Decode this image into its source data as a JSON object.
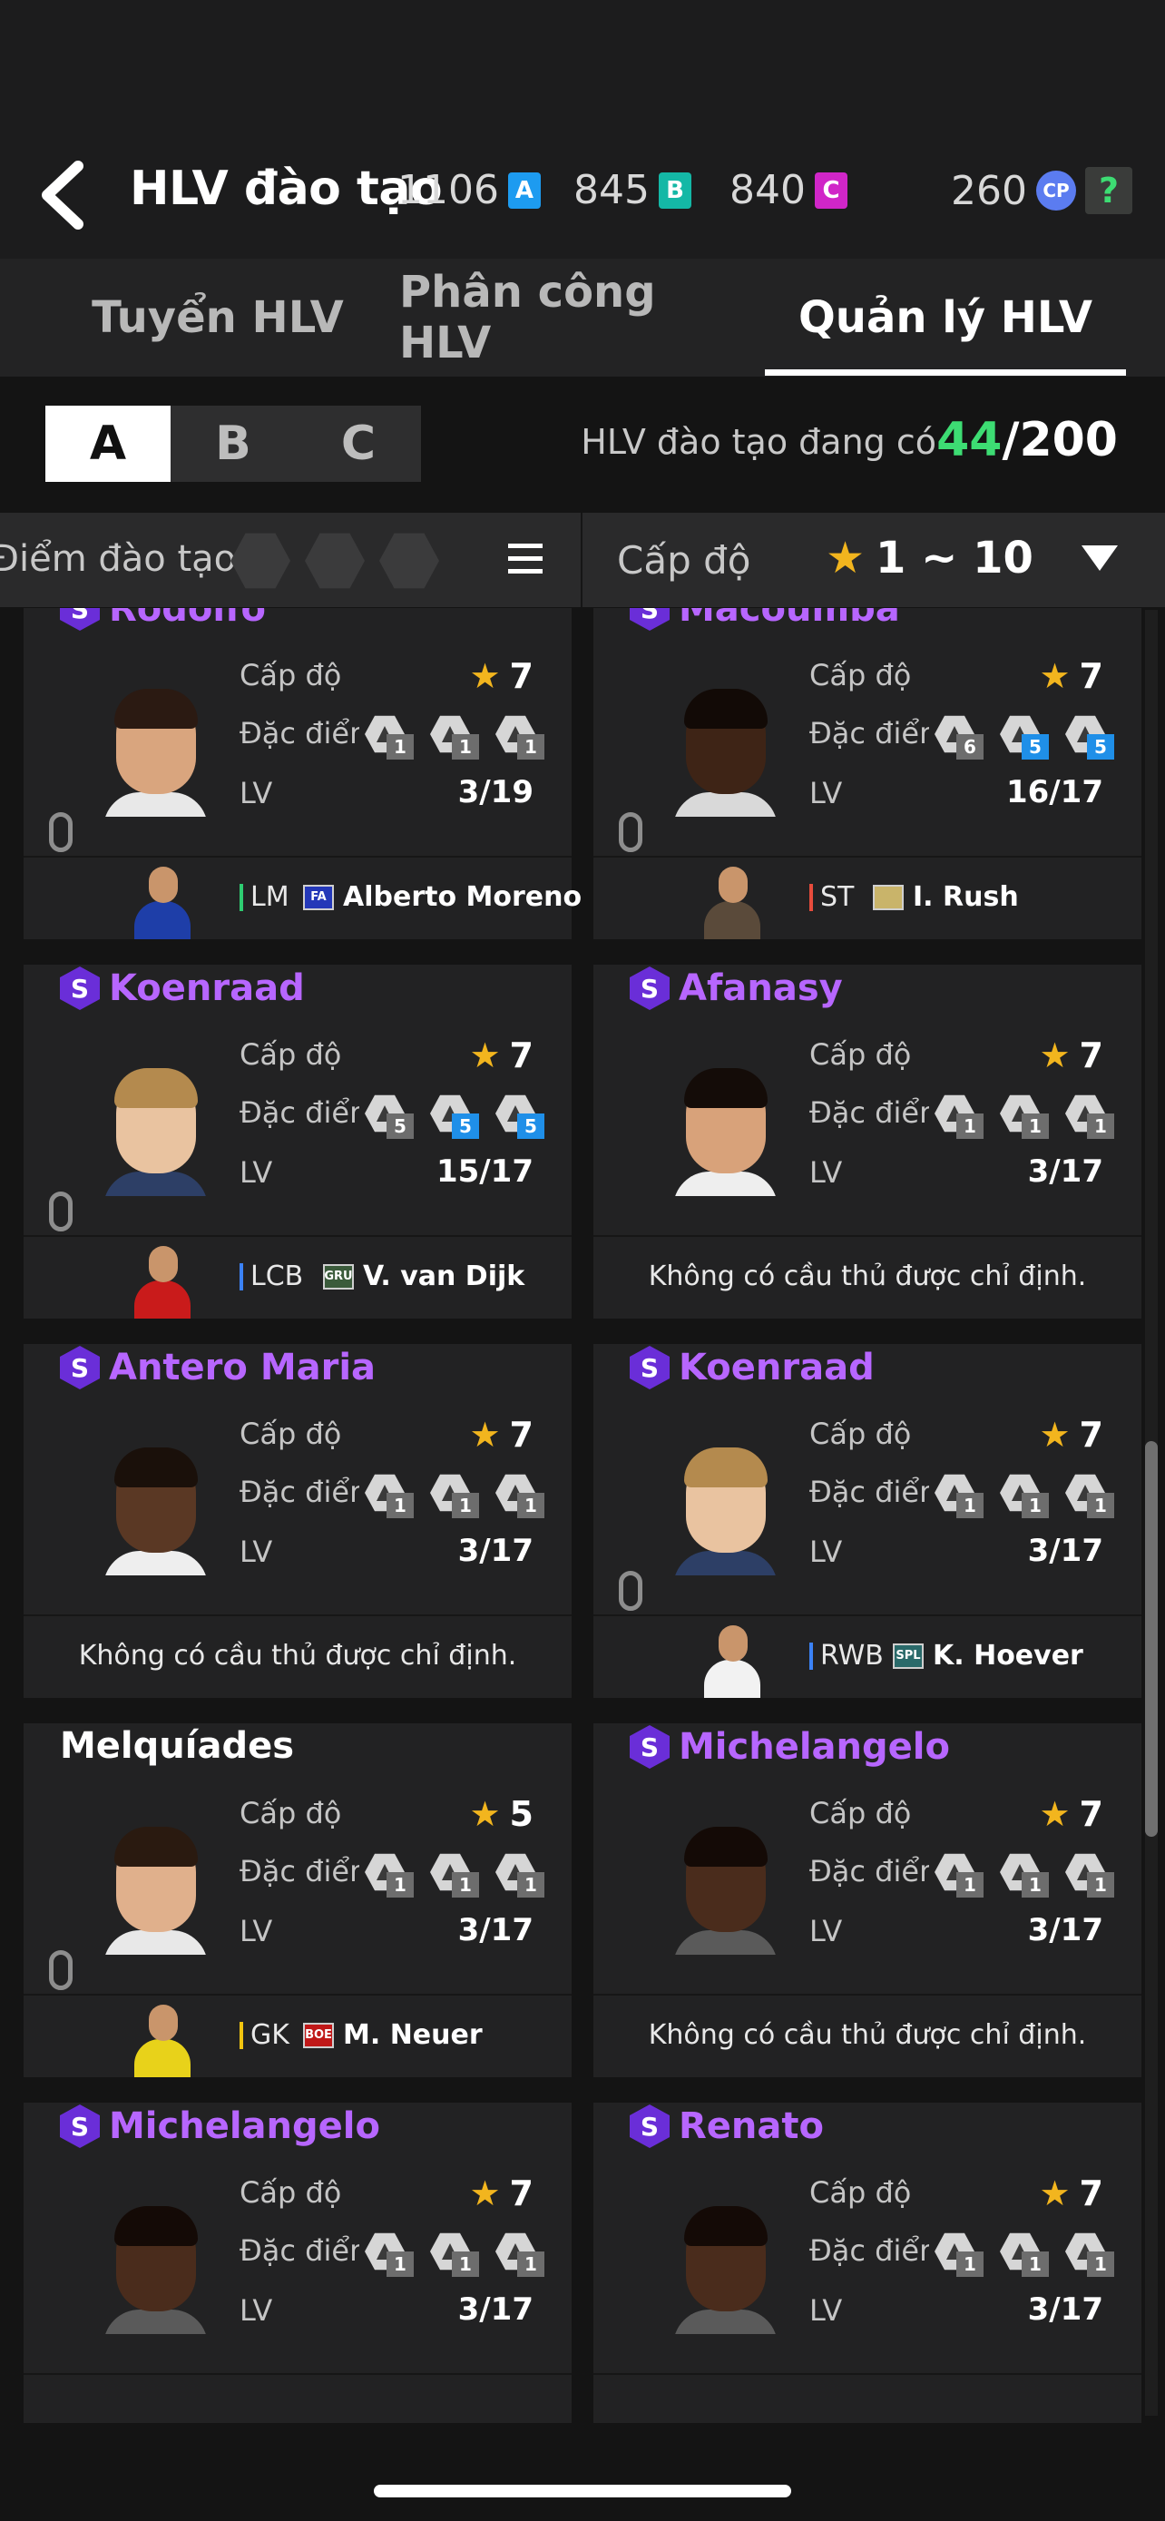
{
  "header": {
    "title": "HLV đào tạo",
    "currencies": [
      {
        "value": "1106",
        "tag": "A",
        "color": "#1d9bf0"
      },
      {
        "value": "845",
        "tag": "B",
        "color": "#14b8a6"
      },
      {
        "value": "840",
        "tag": "C",
        "color": "#d026c8"
      },
      {
        "value": "260",
        "tag": "CP",
        "color": "#5b7cf0"
      }
    ],
    "help": "?"
  },
  "tabs": [
    {
      "label": "Tuyển HLV"
    },
    {
      "label": "Phân công HLV"
    },
    {
      "label": "Quản lý HLV",
      "active": true
    }
  ],
  "groups": [
    "A",
    "B",
    "C"
  ],
  "selected_group": "A",
  "coach_count": {
    "label": "HLV đào tạo đang có",
    "current": "44",
    "total": "/200"
  },
  "filter": {
    "traits_label": "Điểm đào tạo",
    "level_label": "Cấp độ",
    "level_range": "1 ~ 10"
  },
  "labels": {
    "level": "Cấp độ",
    "traits": "Đặc điểm",
    "lv": "LV"
  },
  "cards": [
    {
      "name": "Rodolfo",
      "special": true,
      "level": "7",
      "lv": "3/19",
      "traits": [
        {
          "v": "1"
        },
        {
          "v": "1"
        },
        {
          "v": "1"
        }
      ],
      "skin": "#d9a57e",
      "hair": "#2b1a12",
      "shirt": "#e8e8e8",
      "player": {
        "pos": "LM",
        "pos_color": "#2ecc71",
        "crest": "FA",
        "crest_color": "#2438b8",
        "name": "Alberto Moreno",
        "kit": "#1e3ea8"
      }
    },
    {
      "name": "Macoumba",
      "special": true,
      "level": "7",
      "lv": "16/17",
      "traits": [
        {
          "v": "6"
        },
        {
          "v": "5",
          "blue": true
        },
        {
          "v": "5",
          "blue": true
        }
      ],
      "skin": "#3e2416",
      "hair": "#120a06",
      "shirt": "#d9d9d9",
      "player": {
        "pos": "ST",
        "pos_color": "#e74c3c",
        "crest": "",
        "crest_color": "#c9b46a",
        "name": "I. Rush",
        "kit": "#5a4a3a"
      }
    },
    {
      "name": "Koenraad",
      "special": true,
      "level": "7",
      "lv": "15/17",
      "traits": [
        {
          "v": "5"
        },
        {
          "v": "5",
          "blue": true
        },
        {
          "v": "5",
          "blue": true
        }
      ],
      "skin": "#e9c3a0",
      "hair": "#b48a4e",
      "shirt": "#2d3f66",
      "player": {
        "pos": "LCB",
        "pos_color": "#3b82f6",
        "crest": "GRU",
        "crest_color": "#3b5b3b",
        "name": "V. van Dijk",
        "kit": "#c91b1b"
      }
    },
    {
      "name": "Afanasy",
      "special": true,
      "level": "7",
      "lv": "3/17",
      "traits": [
        {
          "v": "1"
        },
        {
          "v": "1"
        },
        {
          "v": "1"
        }
      ],
      "skin": "#d8a27a",
      "hair": "#140c08",
      "shirt": "#eeeeee",
      "no_player": "Không có cầu thủ được chỉ định."
    },
    {
      "name": "Antero Maria",
      "special": true,
      "level": "7",
      "lv": "3/17",
      "traits": [
        {
          "v": "1"
        },
        {
          "v": "1"
        },
        {
          "v": "1"
        }
      ],
      "skin": "#5a3824",
      "hair": "#1a100a",
      "shirt": "#eeeeee",
      "no_player": "Không có cầu thủ được chỉ định."
    },
    {
      "name": "Koenraad",
      "special": true,
      "level": "7",
      "lv": "3/17",
      "traits": [
        {
          "v": "1"
        },
        {
          "v": "1"
        },
        {
          "v": "1"
        }
      ],
      "skin": "#e9c3a0",
      "hair": "#b48a4e",
      "shirt": "#2d3f66",
      "player": {
        "pos": "RWB",
        "pos_color": "#3b82f6",
        "crest": "SPL",
        "crest_color": "#2a6a6a",
        "name": "K. Hoever",
        "kit": "#f2f2f2"
      }
    },
    {
      "name": "Melquíades",
      "special": false,
      "level": "5",
      "lv": "3/17",
      "traits": [
        {
          "v": "1"
        },
        {
          "v": "1"
        },
        {
          "v": "1"
        }
      ],
      "skin": "#e0b08c",
      "hair": "#2a1a10",
      "shirt": "#e8e8e8",
      "player": {
        "pos": "GK",
        "pos_color": "#f1c40f",
        "crest": "BOE",
        "crest_color": "#c01818",
        "name": "M. Neuer",
        "kit": "#e8d21a"
      }
    },
    {
      "name": "Michelangelo",
      "special": true,
      "level": "7",
      "lv": "3/17",
      "traits": [
        {
          "v": "1"
        },
        {
          "v": "1"
        },
        {
          "v": "1"
        }
      ],
      "skin": "#4a2c1c",
      "hair": "#140a06",
      "shirt": "#5a5a5a",
      "no_player": "Không có cầu thủ được chỉ định."
    },
    {
      "name": "Michelangelo",
      "special": true,
      "level": "7",
      "lv": "3/17",
      "traits": [
        {
          "v": "1"
        },
        {
          "v": "1"
        },
        {
          "v": "1"
        }
      ],
      "skin": "#4a2c1c",
      "hair": "#140a06",
      "shirt": "#5a5a5a"
    },
    {
      "name": "Renato",
      "special": true,
      "level": "7",
      "lv": "3/17",
      "traits": [
        {
          "v": "1"
        },
        {
          "v": "1"
        },
        {
          "v": "1"
        }
      ],
      "skin": "#4a2c1c",
      "hair": "#140a06",
      "shirt": "#5a5a5a"
    }
  ]
}
